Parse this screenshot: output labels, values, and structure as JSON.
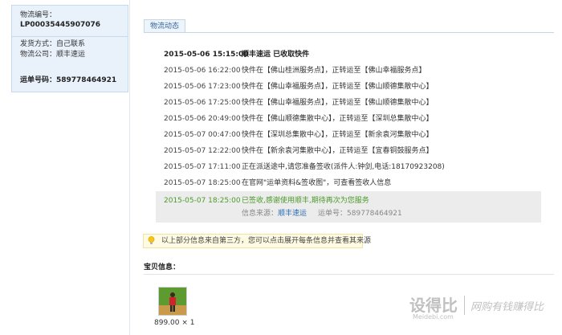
{
  "left_card": {
    "tracking_label": "物流编号：",
    "tracking_number": "LP00035445907076",
    "shipping_method": "发货方式：自己联系",
    "courier_company": "物流公司：顺丰速运",
    "waybill": "运单号码：589778464921"
  },
  "tab": {
    "label": "物流动态"
  },
  "timeline": [
    {
      "time": "2015-05-06 15:15:00",
      "desc": "顺丰速运 已收取快件"
    },
    {
      "time": "2015-05-06 16:22:00",
      "desc": "快件在【佛山桂洲服务点】，正转运至【佛山幸福服务点】"
    },
    {
      "time": "2015-05-06 17:23:00",
      "desc": "快件在【佛山幸福服务点】，正转运至【佛山顺德集散中心】"
    },
    {
      "time": "2015-05-06 17:25:00",
      "desc": "快件在【佛山幸福服务点】，正转运至【佛山顺德集散中心】"
    },
    {
      "time": "2015-05-06 20:49:00",
      "desc": "快件在【佛山顺德集散中心】，正转运至【深圳总集散中心】"
    },
    {
      "time": "2015-05-07 00:47:00",
      "desc": "快件在【深圳总集散中心】，正转运至【新余袁河集散中心】"
    },
    {
      "time": "2015-05-07 12:22:00",
      "desc": "快件在【新余袁河集散中心】，正转运至【宜春铜鼓服务点】"
    },
    {
      "time": "2015-05-07 17:11:00",
      "desc": "正在派送途中,请您准备签收(派件人:钟剑,电话:18170923208)"
    },
    {
      "time": "2015-05-07 18:25:00",
      "desc": "在官网\"运单资料&签收图\"，可查看签收人信息"
    }
  ],
  "timeline_last": {
    "time": "2015-05-07 18:25:00",
    "desc": "已签收,感谢使用顺丰,期待再次为您服务",
    "source_label": "信息来源：",
    "source_link": "顺丰速运",
    "waybill_label": "运单号：589778464921"
  },
  "notice": {
    "icon": "lightbulb-icon",
    "text": "以上部分信息来自第三方，您可以点击展开每条信息并查看其来源"
  },
  "product": {
    "section_title": "宝贝信息：",
    "price_qty": "899.00 × 1"
  },
  "watermark": {
    "logo": "设得比",
    "sub": "Meidebi.com",
    "slogan": "网购有钱赚得比"
  },
  "colors": {
    "card_bg": "#e9f2fb",
    "success_green": "#4c9a2a",
    "link_blue": "#2a6cb4",
    "notice_bg": "#fffbe2"
  }
}
